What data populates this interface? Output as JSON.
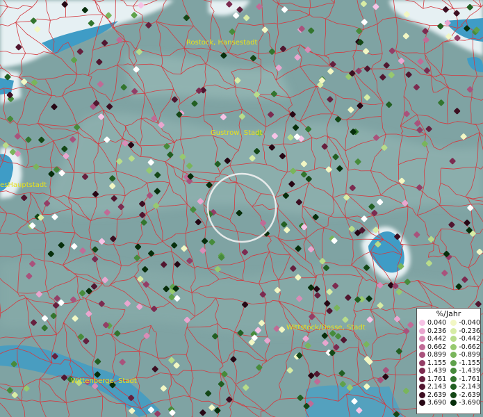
{
  "map": {
    "cities": [
      {
        "name": "Rostock, Hansestadt"
      },
      {
        "name": "Gustrow, Stadt"
      },
      {
        "name": "esHauptstadt"
      },
      {
        "name": "Wittstock/Dosse, Stadt"
      },
      {
        "name": "Wittenberge, Stadt"
      }
    ],
    "colors": {
      "land": "#7fa3a3",
      "water": "#3f9cc6",
      "snow": "#e6f0f3",
      "boundary": "#d4393f",
      "label": "#e8e01c",
      "selection_ring": "#f1f1f1"
    }
  },
  "legend": {
    "title": "%/Jahr",
    "positive": [
      {
        "value": "0.040",
        "color": "#f7c3e6"
      },
      {
        "value": "0.236",
        "color": "#e9a6cf"
      },
      {
        "value": "0.442",
        "color": "#d98cb7"
      },
      {
        "value": "0.662",
        "color": "#c06b96"
      },
      {
        "value": "0.899",
        "color": "#a9527c"
      },
      {
        "value": "1.155",
        "color": "#933e66"
      },
      {
        "value": "1.439",
        "color": "#7c2b50"
      },
      {
        "value": "1.761",
        "color": "#66203e"
      },
      {
        "value": "2.143",
        "color": "#51162f"
      },
      {
        "value": "2.639",
        "color": "#3c0e21"
      },
      {
        "value": "3.690",
        "color": "#260714"
      }
    ],
    "negative": [
      {
        "value": "-0.040",
        "color": "#f2f7c4"
      },
      {
        "value": "-0.236",
        "color": "#d7eca5"
      },
      {
        "value": "-0.442",
        "color": "#b8dc8a"
      },
      {
        "value": "-0.662",
        "color": "#97c96f"
      },
      {
        "value": "-0.899",
        "color": "#79b55b"
      },
      {
        "value": "-1.155",
        "color": "#5fa14b"
      },
      {
        "value": "-1.439",
        "color": "#478b3b"
      },
      {
        "value": "-1.761",
        "color": "#33752e"
      },
      {
        "value": "-2.143",
        "color": "#225f22"
      },
      {
        "value": "-2.639",
        "color": "#144716"
      },
      {
        "value": "-3.690",
        "color": "#072e0b"
      }
    ]
  }
}
